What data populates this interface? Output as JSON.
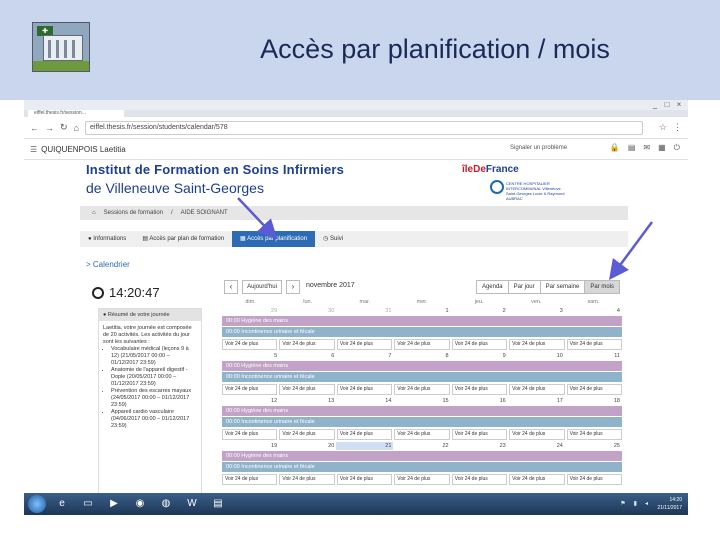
{
  "slide": {
    "title": "Accès par planification / mois"
  },
  "browser": {
    "tab_label": "eiffel.thesis.fr/session...",
    "url": "eiffel.thesis.fr/session/students/calendar/578",
    "window_controls": [
      "_",
      "□",
      "×"
    ]
  },
  "app": {
    "user_name": "QUIQUENPOIS Laetitia",
    "report_label": "Signaler un problème",
    "institute_line1": "Institut de Formation en Soins Infirmiers",
    "institute_line2": "de Villeneuve Saint-Georges",
    "idf_label_a": "îleDe",
    "idf_label_b": "France",
    "chi_label": "CENTRE HOSPITALIER INTERCOMMUNAL Villeneuve Saint-Georges Lucie & Raymond AUBRAC",
    "breadcrumb": [
      "Sessions de formation",
      "AIDE SOIGNANT"
    ],
    "tabs": [
      "Informations",
      "Accès par plan de formation",
      "Accès par planification",
      "Suivi"
    ],
    "active_tab": "Accès par planification",
    "side_heading": "> Calendrier",
    "clock": "14:20:47",
    "resume_title": "Résumé de votre journée",
    "resume_intro": "Laetitia, votre journée est composée de 20 activités. Les activités du jour sont les suivantes :",
    "resume_items": [
      "Vocabulaire médical (leçons 9 à 12) (21/05/2017 00:00 – 01/12/2017 23:59)",
      "Anatomie de l'appareil digestif - Dople (20/05/2017 00:00 – 01/12/2017 23:59)",
      "Prévention des escarres mayaux (24/05/2017 00:00 – 01/12/2017 23:59)",
      "Appareil cardio vasculaire (04/06/2017 00:00 – 01/12/2017 23:59)"
    ]
  },
  "calendar": {
    "today_label": "Aujourd'hui",
    "month_label": "novembre 2017",
    "views": [
      "Agenda",
      "Par jour",
      "Par semaine",
      "Par mois"
    ],
    "active_view": "Par mois",
    "weekdays": [
      "dim.",
      "lun.",
      "mar.",
      "mer.",
      "jeu.",
      "ven.",
      "sam."
    ],
    "weeks": [
      {
        "days": [
          "29",
          "30",
          "31",
          "1",
          "2",
          "3",
          "4"
        ],
        "other": [
          true,
          true,
          true,
          false,
          false,
          false,
          false
        ]
      },
      {
        "days": [
          "5",
          "6",
          "7",
          "8",
          "9",
          "10",
          "11"
        ],
        "other": [
          false,
          false,
          false,
          false,
          false,
          false,
          false
        ]
      },
      {
        "days": [
          "12",
          "13",
          "14",
          "15",
          "16",
          "17",
          "18"
        ],
        "other": [
          false,
          false,
          false,
          false,
          false,
          false,
          false
        ]
      },
      {
        "days": [
          "19",
          "20",
          "21",
          "22",
          "23",
          "24",
          "25"
        ],
        "other": [
          false,
          false,
          false,
          false,
          false,
          false,
          false
        ]
      }
    ],
    "today_day": "21",
    "event_pink": "00:00 Hygiène des mains",
    "event_blue": "00:00 Incontinence urinaire et fécale",
    "more_label": "Voir 24 de plus"
  },
  "taskbar": {
    "time": "14:20",
    "date": "21/11/2017"
  },
  "colors": {
    "header_bg": "#c9d6ee",
    "title": "#1b2a55",
    "accent": "#2d6bb5",
    "event_pink": "#c2a2c6",
    "event_blue": "#8fb3cb",
    "arrow": "#5b5bd6"
  }
}
